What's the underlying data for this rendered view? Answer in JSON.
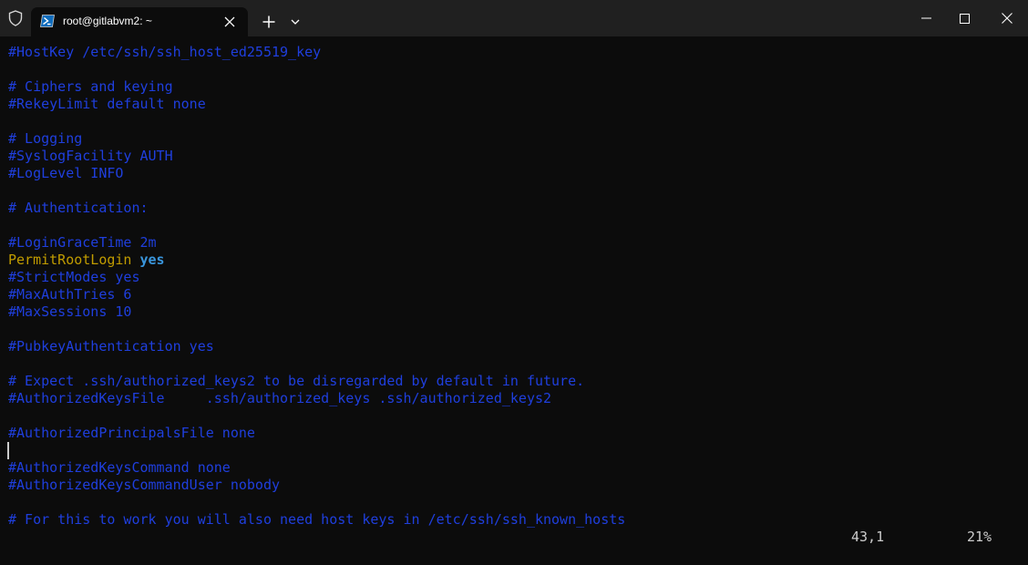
{
  "window": {
    "tab_title": "root@gitlabvm2: ~"
  },
  "icons": {
    "shield": "shield-icon",
    "tab": "powershell-icon",
    "tab_close": "close-icon",
    "new_tab": "plus-icon",
    "dropdown": "chevron-down-icon",
    "minimize": "minimize-icon",
    "maximize": "maximize-icon",
    "close": "close-icon"
  },
  "colors": {
    "background": "#0c0c0c",
    "titlebar": "#202020",
    "comment": "#1f3fde",
    "keyword": "#c19c00",
    "value": "#3a96dd",
    "status_text": "#cccccc"
  },
  "terminal": {
    "lines": [
      {
        "text": "#HostKey /etc/ssh/ssh_host_ed25519_key"
      },
      {
        "text": ""
      },
      {
        "text": "# Ciphers and keying"
      },
      {
        "text": "#RekeyLimit default none"
      },
      {
        "text": ""
      },
      {
        "text": "# Logging"
      },
      {
        "text": "#SyslogFacility AUTH"
      },
      {
        "text": "#LogLevel INFO"
      },
      {
        "text": ""
      },
      {
        "text": "# Authentication:"
      },
      {
        "text": ""
      },
      {
        "text": "#LoginGraceTime 2m"
      },
      {
        "key": "PermitRootLogin",
        "sep": " ",
        "value": "yes"
      },
      {
        "text": "#StrictModes yes"
      },
      {
        "text": "#MaxAuthTries 6"
      },
      {
        "text": "#MaxSessions 10"
      },
      {
        "text": ""
      },
      {
        "text": "#PubkeyAuthentication yes"
      },
      {
        "text": ""
      },
      {
        "text": "# Expect .ssh/authorized_keys2 to be disregarded by default in future."
      },
      {
        "text": "#AuthorizedKeysFile     .ssh/authorized_keys .ssh/authorized_keys2"
      },
      {
        "text": ""
      },
      {
        "text": "#AuthorizedPrincipalsFile none"
      },
      {
        "text": ""
      },
      {
        "text": "#AuthorizedKeysCommand none"
      },
      {
        "text": "#AuthorizedKeysCommandUser nobody"
      },
      {
        "text": ""
      },
      {
        "text": "# For this to work you will also need host keys in /etc/ssh/ssh_known_hosts"
      }
    ],
    "cursor_line": 23,
    "status": {
      "position": "43,1",
      "percent": "21%"
    }
  }
}
